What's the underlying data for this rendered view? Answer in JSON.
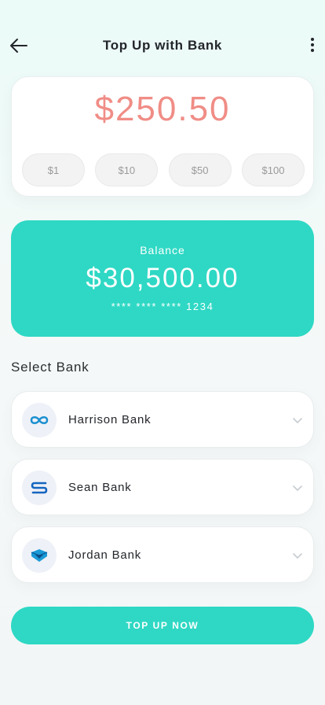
{
  "header": {
    "title": "Top Up with Bank",
    "back_icon": "arrow-left-icon",
    "menu_icon": "more-vertical-icon"
  },
  "amount": {
    "value": "$250.50",
    "color": "#f08d86"
  },
  "quick_amounts": [
    "$1",
    "$10",
    "$50",
    "$100"
  ],
  "balance": {
    "label": "Balance",
    "value": "$30,500.00",
    "card_number": "**** **** **** 1234",
    "color": "#2ed8c4"
  },
  "select_bank": {
    "title": "Select Bank",
    "banks": [
      {
        "name": "Harrison Bank",
        "icon": "infinity-logo-icon"
      },
      {
        "name": "Sean Bank",
        "icon": "s-logo-icon"
      },
      {
        "name": "Jordan Bank",
        "icon": "gem-logo-icon"
      }
    ]
  },
  "action": {
    "label": "TOP UP NOW"
  }
}
